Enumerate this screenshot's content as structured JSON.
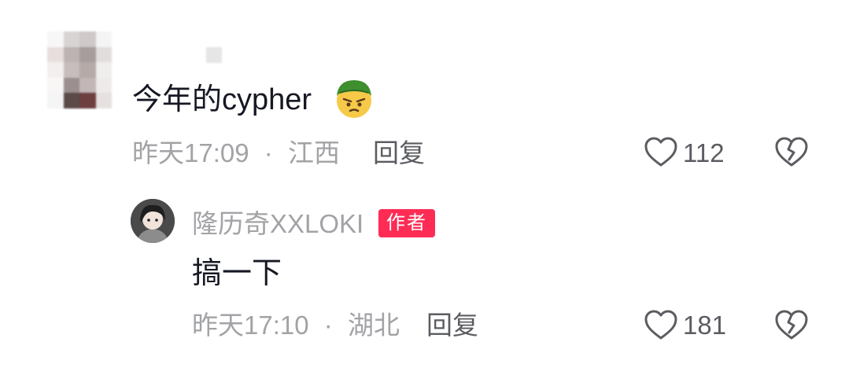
{
  "comment": {
    "text": "今年的cypher",
    "emoji": "smiling-face-with-green-hat-emoji",
    "time": "昨天17:09",
    "separator": "·",
    "location": "江西",
    "reply_label": "回复",
    "like_count": "112"
  },
  "reply": {
    "author": "隆历奇XXLOKI",
    "badge": "作者",
    "text": "搞一下",
    "time": "昨天17:10",
    "separator": "·",
    "location": "湖北",
    "reply_label": "回复",
    "like_count": "181"
  },
  "colors": {
    "badge": "#fe2c55",
    "text": "#161823",
    "meta": "#a2a3a6"
  }
}
